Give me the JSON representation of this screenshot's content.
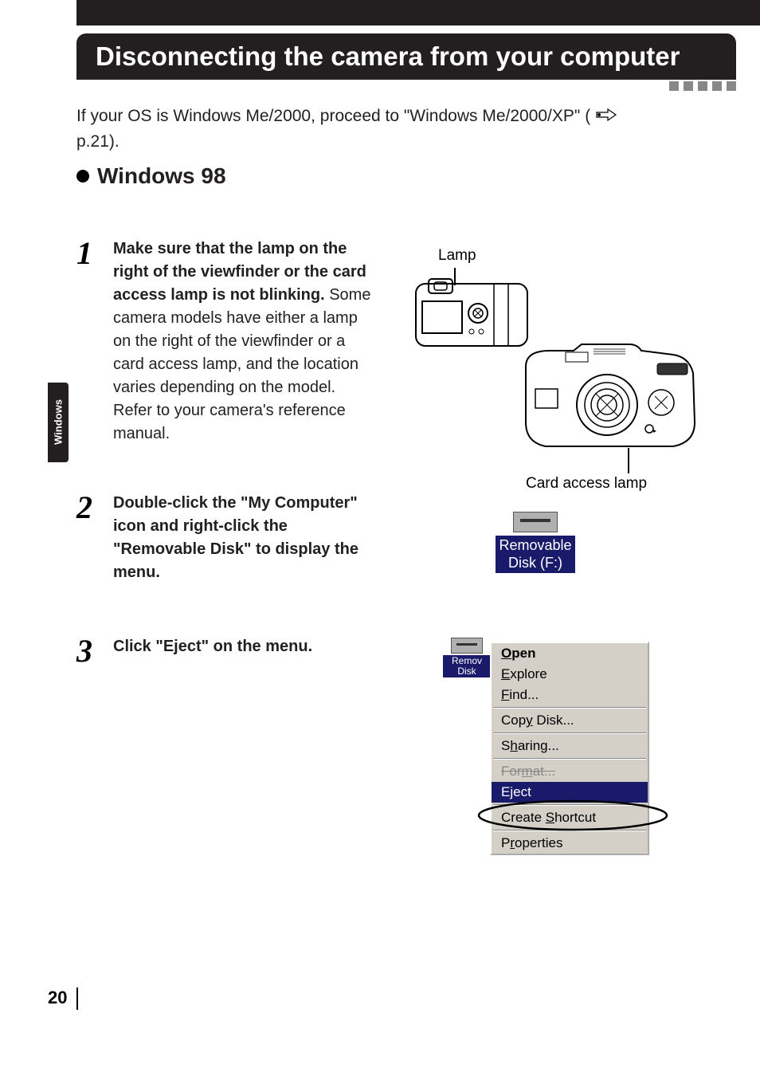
{
  "title": "Disconnecting the camera from your computer",
  "intro_line1": "If your OS is Windows Me/2000, proceed to \"Windows Me/2000/XP\" (",
  "intro_line2": "p.21).",
  "section": "Windows 98",
  "side_tab": "Windows",
  "page_number": "20",
  "labels": {
    "lamp": "Lamp",
    "card_access": "Card access lamp"
  },
  "removable": {
    "line1": "Removable",
    "line2": "Disk (F:)"
  },
  "remov_small": {
    "line1": "Remov",
    "line2": "Disk"
  },
  "steps": [
    {
      "num": "1",
      "bold": "Make sure that the lamp on the right of the viewfinder or the card access lamp is not blinking.",
      "rest": "Some camera models have either a lamp on the right of the viewfinder or a card access lamp, and the location varies depending on the model. Refer to your camera's reference manual."
    },
    {
      "num": "2",
      "bold": "Double-click the \"My Computer\" icon and right-click the \"Removable Disk\" to display the menu.",
      "rest": ""
    },
    {
      "num": "3",
      "bold": "Click \"Eject\" on the menu.",
      "rest": ""
    }
  ],
  "menu": {
    "open": "Open",
    "explore": "Explore",
    "find": "Find...",
    "copy": "Copy Disk...",
    "sharing": "Sharing...",
    "format": "Format...",
    "eject": "Eject",
    "shortcut": "Create Shortcut",
    "properties": "Properties"
  }
}
